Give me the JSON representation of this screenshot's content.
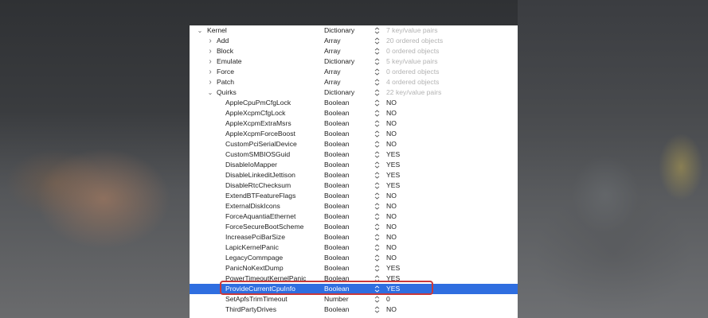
{
  "plist": {
    "rows": [
      {
        "key": "Kernel",
        "type": "Dictionary",
        "value": "7 key/value pairs",
        "disclosure": "expanded",
        "muted": true,
        "level": 0
      },
      {
        "key": "Add",
        "type": "Array",
        "value": "20 ordered objects",
        "disclosure": "collapsed",
        "muted": true,
        "level": 1
      },
      {
        "key": "Block",
        "type": "Array",
        "value": "0 ordered objects",
        "disclosure": "collapsed",
        "muted": true,
        "level": 1
      },
      {
        "key": "Emulate",
        "type": "Dictionary",
        "value": "5 key/value pairs",
        "disclosure": "collapsed",
        "muted": true,
        "level": 1
      },
      {
        "key": "Force",
        "type": "Array",
        "value": "0 ordered objects",
        "disclosure": "collapsed",
        "muted": true,
        "level": 1
      },
      {
        "key": "Patch",
        "type": "Array",
        "value": "4 ordered objects",
        "disclosure": "collapsed",
        "muted": true,
        "level": 1
      },
      {
        "key": "Quirks",
        "type": "Dictionary",
        "value": "22 key/value pairs",
        "disclosure": "expanded",
        "muted": true,
        "level": 1
      },
      {
        "key": "AppleCpuPmCfgLock",
        "type": "Boolean",
        "value": "NO",
        "level": 2
      },
      {
        "key": "AppleXcpmCfgLock",
        "type": "Boolean",
        "value": "NO",
        "level": 2
      },
      {
        "key": "AppleXcpmExtraMsrs",
        "type": "Boolean",
        "value": "NO",
        "level": 2
      },
      {
        "key": "AppleXcpmForceBoost",
        "type": "Boolean",
        "value": "NO",
        "level": 2
      },
      {
        "key": "CustomPciSerialDevice",
        "type": "Boolean",
        "value": "NO",
        "level": 2
      },
      {
        "key": "CustomSMBIOSGuid",
        "type": "Boolean",
        "value": "YES",
        "level": 2
      },
      {
        "key": "DisableIoMapper",
        "type": "Boolean",
        "value": "YES",
        "level": 2
      },
      {
        "key": "DisableLinkeditJettison",
        "type": "Boolean",
        "value": "YES",
        "level": 2
      },
      {
        "key": "DisableRtcChecksum",
        "type": "Boolean",
        "value": "YES",
        "level": 2
      },
      {
        "key": "ExtendBTFeatureFlags",
        "type": "Boolean",
        "value": "NO",
        "level": 2
      },
      {
        "key": "ExternalDiskIcons",
        "type": "Boolean",
        "value": "NO",
        "level": 2
      },
      {
        "key": "ForceAquantiaEthernet",
        "type": "Boolean",
        "value": "NO",
        "level": 2
      },
      {
        "key": "ForceSecureBootScheme",
        "type": "Boolean",
        "value": "NO",
        "level": 2
      },
      {
        "key": "IncreasePciBarSize",
        "type": "Boolean",
        "value": "NO",
        "level": 2
      },
      {
        "key": "LapicKernelPanic",
        "type": "Boolean",
        "value": "NO",
        "level": 2
      },
      {
        "key": "LegacyCommpage",
        "type": "Boolean",
        "value": "NO",
        "level": 2
      },
      {
        "key": "PanicNoKextDump",
        "type": "Boolean",
        "value": "YES",
        "level": 2
      },
      {
        "key": "PowerTimeoutKernelPanic",
        "type": "Boolean",
        "value": "YES",
        "level": 2
      },
      {
        "key": "ProvideCurrentCpuInfo",
        "type": "Boolean",
        "value": "YES",
        "level": 2,
        "selected": true
      },
      {
        "key": "SetApfsTrimTimeout",
        "type": "Number",
        "value": "0",
        "level": 2
      },
      {
        "key": "ThirdPartyDrives",
        "type": "Boolean",
        "value": "NO",
        "level": 2
      }
    ]
  },
  "colors": {
    "selection": "#2f6ee0",
    "highlight_outline": "#c9383a",
    "muted_value": "#b3b3b3"
  },
  "icons": {
    "expanded": "chevron-down-icon",
    "collapsed": "chevron-right-icon",
    "stepper": "up-down-stepper-icon"
  }
}
